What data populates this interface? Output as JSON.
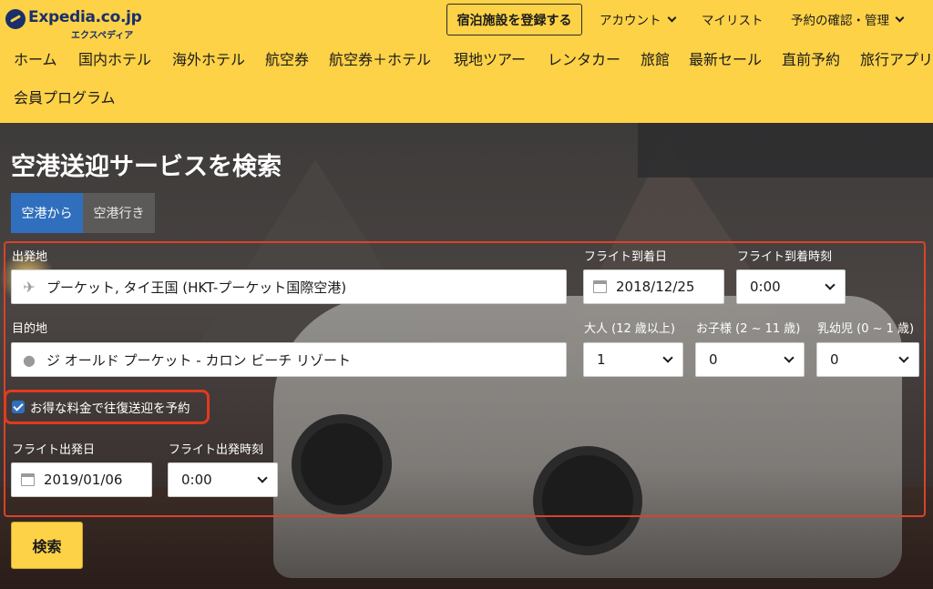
{
  "header": {
    "logo_main": "Expedia.co.jp",
    "logo_sub": "エクスペディア",
    "register_button": "宿泊施設を登録する",
    "account_label": "アカウント",
    "mylist_label": "マイリスト",
    "reservation_label": "予約の確認・管理"
  },
  "nav": {
    "items": [
      "ホーム",
      "国内ホテル",
      "海外ホテル",
      "航空券",
      "航空券＋ホテル",
      "現地ツアー",
      "レンタカー",
      "旅館",
      "最新セール",
      "直前予約",
      "旅行アプリ",
      "会員プログラム"
    ]
  },
  "search": {
    "title": "空港送迎サービスを検索",
    "tabs": [
      "空港から",
      "空港行き"
    ],
    "active_tab": "空港から",
    "origin_label": "出発地",
    "origin_value": "プーケット, タイ王国 (HKT-プーケット国際空港)",
    "destination_label": "目的地",
    "destination_value": "ジ オールド プーケット - カロン ビーチ リゾート",
    "arrival_date_label": "フライト到着日",
    "arrival_date_value": "2018/12/25",
    "arrival_time_label": "フライト到着時刻",
    "arrival_time_value": "0:00",
    "adults_label": "大人 (12 歳以上)",
    "adults_value": "1",
    "children_label": "お子様 (2 ~ 11 歳)",
    "children_value": "0",
    "infants_label": "乳幼児 (0 ~ 1 歳)",
    "infants_value": "0",
    "roundtrip_label": "お得な料金で往復送迎を予約",
    "roundtrip_checked": true,
    "departure_date_label": "フライト出発日",
    "departure_date_value": "2019/01/06",
    "departure_time_label": "フライト出発時刻",
    "departure_time_value": "0:00",
    "search_button": "検索"
  },
  "colors": {
    "header_bg": "#fdd247",
    "brand_navy": "#1b2f6a",
    "tab_active": "#2f6fbd",
    "highlight_red": "#e23a1e"
  }
}
